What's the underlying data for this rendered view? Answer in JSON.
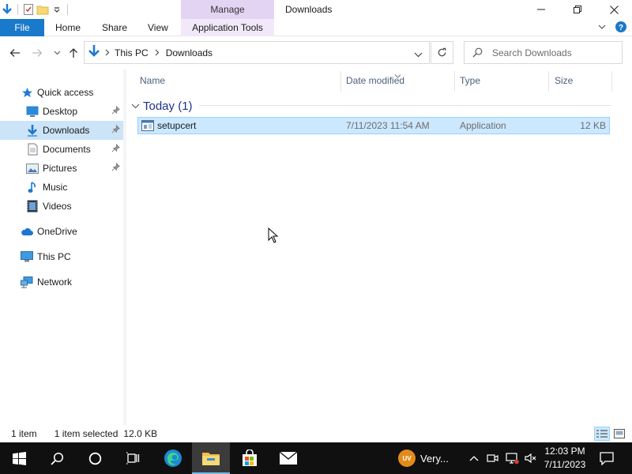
{
  "window": {
    "title": "Downloads",
    "context_tab": "Manage",
    "controls": {
      "minimize_icon": "minimize-icon",
      "maximize_icon": "maximize-icon",
      "close_icon": "close-icon"
    }
  },
  "ribbon": {
    "tabs": [
      "File",
      "Home",
      "Share",
      "View",
      "Application Tools"
    ],
    "accent": "#1979ca",
    "manage_color": "#e4d4f4"
  },
  "address": {
    "crumbs": [
      "This PC",
      "Downloads"
    ]
  },
  "search": {
    "placeholder": "Search Downloads"
  },
  "sidebar": {
    "items": [
      {
        "label": "Quick access",
        "icon": "star-icon"
      },
      {
        "label": "Desktop",
        "icon": "desktop-icon",
        "pinned": true
      },
      {
        "label": "Downloads",
        "icon": "download-icon",
        "pinned": true,
        "selected": true
      },
      {
        "label": "Documents",
        "icon": "document-icon",
        "pinned": true
      },
      {
        "label": "Pictures",
        "icon": "picture-icon",
        "pinned": true
      },
      {
        "label": "Music",
        "icon": "music-icon"
      },
      {
        "label": "Videos",
        "icon": "video-icon"
      },
      {
        "label": "OneDrive",
        "icon": "cloud-icon"
      },
      {
        "label": "This PC",
        "icon": "computer-icon"
      },
      {
        "label": "Network",
        "icon": "network-icon"
      }
    ]
  },
  "columns": [
    "Name",
    "Date modified",
    "Type",
    "Size"
  ],
  "group": {
    "label": "Today (1)"
  },
  "files": [
    {
      "name": "setupcert",
      "date": "7/11/2023 11:54 AM",
      "type": "Application",
      "size": "12 KB",
      "selected": true
    }
  ],
  "status": {
    "count": "1 item",
    "selection": "1 item selected",
    "selection_size": "12.0 KB"
  },
  "taskbar": {
    "weather_badge": "UV",
    "weather_text": "Very...",
    "time": "12:03 PM",
    "date": "7/11/2023"
  }
}
